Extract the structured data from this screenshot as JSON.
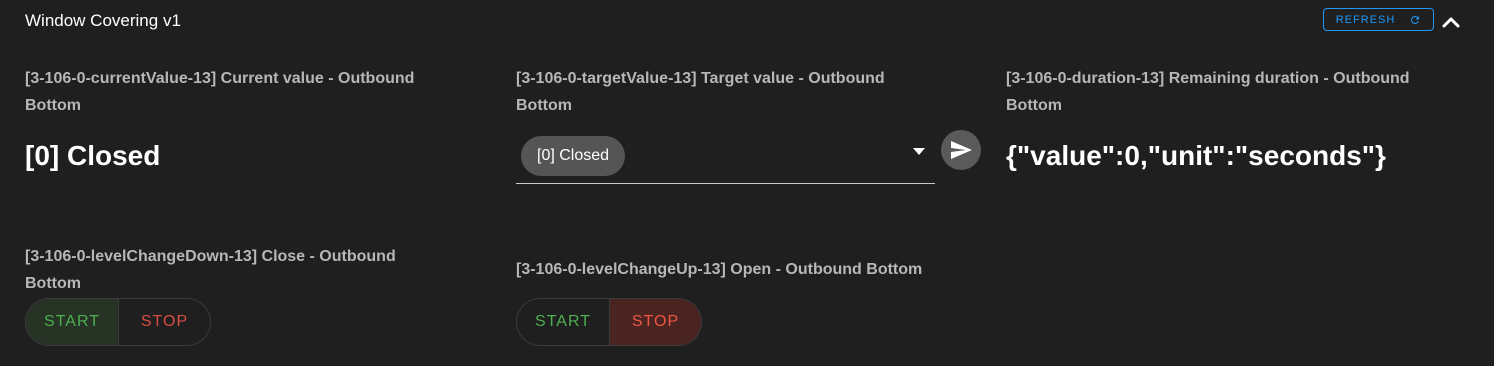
{
  "panel": {
    "title": "Window Covering v1",
    "refresh_label": "REFRESH"
  },
  "current_value": {
    "label_line1": "[3-106-0-currentValue-13] Current value - Outbound",
    "label_line2": "Bottom",
    "value": "[0] Closed"
  },
  "target_value": {
    "label_line1": "[3-106-0-targetValue-13] Target value - Outbound",
    "label_line2": "Bottom",
    "selected": "[0] Closed"
  },
  "duration": {
    "label_line1": "[3-106-0-duration-13] Remaining duration - Outbound",
    "label_line2": "Bottom",
    "value": "{\"value\":0,\"unit\":\"seconds\"}"
  },
  "level_change_down": {
    "label_line1": "[3-106-0-levelChangeDown-13] Close - Outbound",
    "label_line2": "Bottom",
    "start_label": "START",
    "stop_label": "STOP"
  },
  "level_change_up": {
    "label": "[3-106-0-levelChangeUp-13] Open - Outbound Bottom",
    "start_label": "START",
    "stop_label": "STOP"
  },
  "colors": {
    "background": "#1f1f1f",
    "accent": "#2196f3",
    "start_green": "#4caf50",
    "stop_red": "#d94c41"
  },
  "icons": {
    "refresh": "refresh-icon",
    "collapse": "chevron-up-icon",
    "dropdown": "caret-down-icon",
    "send": "send-icon"
  }
}
